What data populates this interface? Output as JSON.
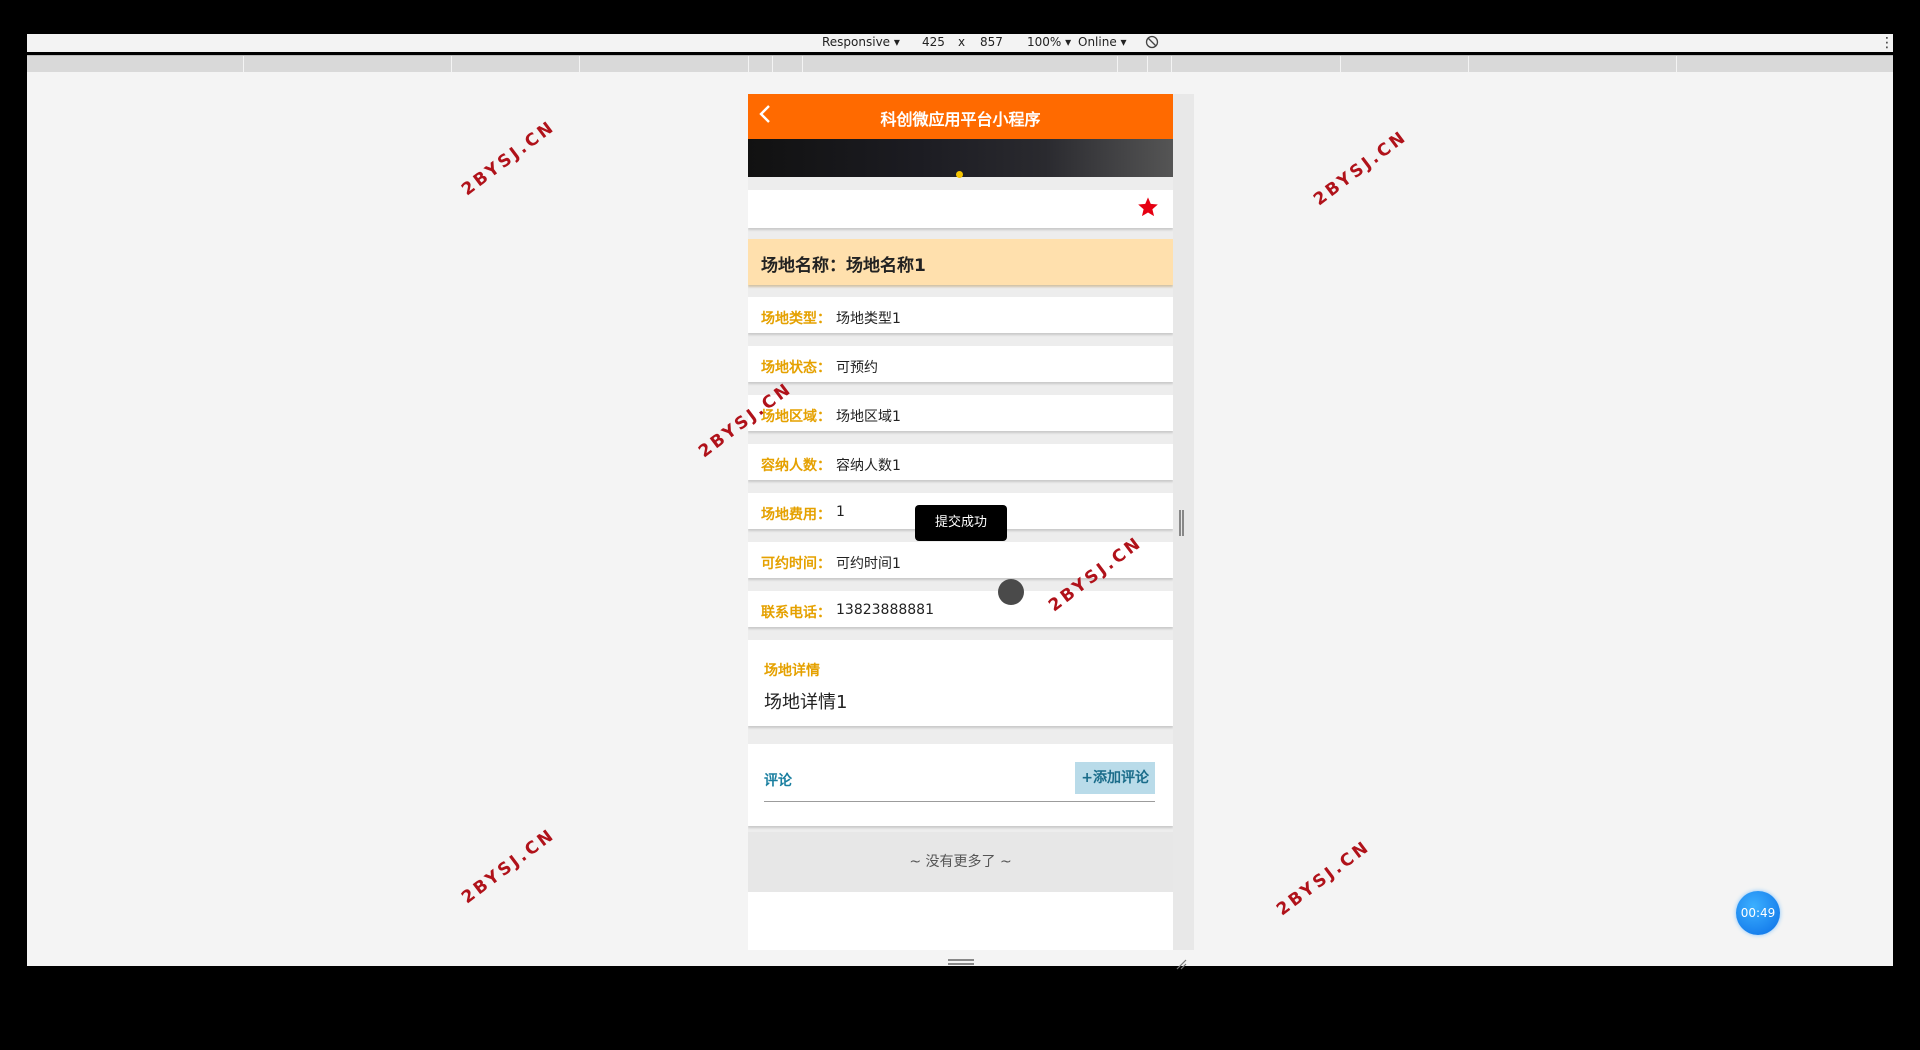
{
  "devtools": {
    "device": "Responsive",
    "width": "425",
    "times": "x",
    "height": "857",
    "zoom": "100%",
    "network": "Online"
  },
  "app": {
    "title": "科创微应用平台小程序",
    "back_icon": "chevron-left-icon",
    "favorite_icon": "star-icon",
    "colors": {
      "header": "#ff6a00",
      "label": "#e5a100",
      "comment": "#1a7fa0"
    }
  },
  "venue": {
    "name_label": "场地名称：",
    "name_value": "场地名称1",
    "fields": [
      {
        "label": "场地类型：",
        "value": "场地类型1"
      },
      {
        "label": "场地状态：",
        "value": "可预约"
      },
      {
        "label": "场地区域：",
        "value": "场地区域1"
      },
      {
        "label": "容纳人数：",
        "value": "容纳人数1"
      },
      {
        "label": "场地费用：",
        "value": "1"
      },
      {
        "label": "可约时间：",
        "value": "可约时间1"
      },
      {
        "label": "联系电话：",
        "value": "13823888881"
      }
    ],
    "detail_title": "场地详情",
    "detail_body": "场地详情1"
  },
  "comments": {
    "title": "评论",
    "add_button": "+添加评论",
    "empty_text": "~ 没有更多了 ~"
  },
  "toast": "提交成功",
  "timer": "00:49",
  "watermark": "2BYSJ.CN"
}
